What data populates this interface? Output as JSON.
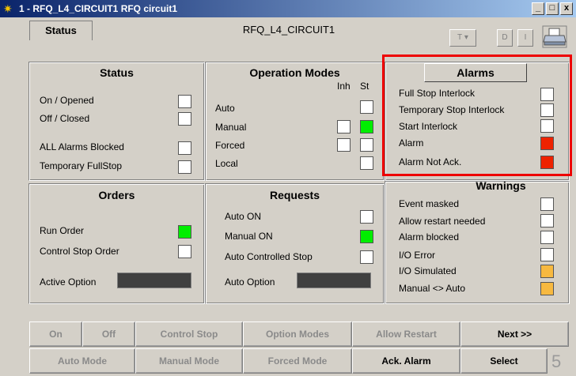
{
  "window": {
    "title": "1 - RFQ_L4_CIRCUIT1 RFQ circuit1",
    "minimize": "_",
    "maximize": "□",
    "close": "x"
  },
  "header": {
    "tab_label": "Status",
    "title": "RFQ_L4_CIRCUIT1",
    "buttons": [
      "T",
      "D",
      "I"
    ],
    "t_caret": "▾"
  },
  "status_panel": {
    "title": "Status",
    "items": [
      {
        "label": "On / Opened",
        "state": "white"
      },
      {
        "label": "Off / Closed",
        "state": "white"
      },
      {
        "label": "ALL Alarms Blocked",
        "state": "white"
      },
      {
        "label": "Temporary FullStop",
        "state": "white"
      }
    ]
  },
  "operation_modes": {
    "title": "Operation Modes",
    "col_inh": "Inh",
    "col_st": "St",
    "items": [
      {
        "label": "Auto",
        "inh": null,
        "st": "white"
      },
      {
        "label": "Manual",
        "inh": "white",
        "st": "green"
      },
      {
        "label": "Forced",
        "inh": "white",
        "st": "white"
      },
      {
        "label": "Local",
        "inh": null,
        "st": "white"
      }
    ]
  },
  "alarms": {
    "title": "Alarms",
    "items": [
      {
        "label": "Full Stop Interlock",
        "state": "white"
      },
      {
        "label": "Temporary Stop Interlock",
        "state": "white"
      },
      {
        "label": "Start Interlock",
        "state": "white"
      },
      {
        "label": "Alarm",
        "state": "red"
      },
      {
        "label": "Alarm Not Ack.",
        "state": "red"
      }
    ]
  },
  "orders": {
    "title": "Orders",
    "items": [
      {
        "label": "Run Order",
        "state": "green"
      },
      {
        "label": "Control Stop Order",
        "state": "white"
      }
    ],
    "active_option_label": "Active Option"
  },
  "requests": {
    "title": "Requests",
    "items": [
      {
        "label": "Auto ON",
        "state": "white"
      },
      {
        "label": "Manual ON",
        "state": "green"
      },
      {
        "label": "Auto Controlled Stop",
        "state": "white"
      }
    ],
    "auto_option_label": "Auto Option"
  },
  "warnings": {
    "title": "Warnings",
    "items": [
      {
        "label": "Event masked",
        "state": "white"
      },
      {
        "label": "Allow restart needed",
        "state": "white"
      },
      {
        "label": "Alarm blocked",
        "state": "white"
      },
      {
        "label": "I/O Error",
        "state": "white"
      },
      {
        "label": "I/O Simulated",
        "state": "orange"
      },
      {
        "label": "Manual <> Auto",
        "state": "orange"
      }
    ]
  },
  "buttons_row1": [
    {
      "label": "On",
      "enabled": false
    },
    {
      "label": "Off",
      "enabled": false
    },
    {
      "label": "Control Stop",
      "enabled": false
    },
    {
      "label": "Option Modes",
      "enabled": false
    },
    {
      "label": "Allow Restart",
      "enabled": false
    },
    {
      "label": "Next >>",
      "enabled": true
    }
  ],
  "buttons_row2": [
    {
      "label": "Auto Mode",
      "enabled": false
    },
    {
      "label": "Manual Mode",
      "enabled": false
    },
    {
      "label": "Forced Mode",
      "enabled": false
    },
    {
      "label": "Ack. Alarm",
      "enabled": true
    },
    {
      "label": "Select",
      "enabled": true
    }
  ],
  "corner_number": "5",
  "colors": {
    "white": "#ffffff",
    "green": "#00ee00",
    "red": "#ee2200",
    "orange": "#f7b940",
    "highlight_frame": "#ee0000"
  },
  "icons": {
    "app_icon": "gear-icon",
    "print_icon": "printer-icon"
  }
}
